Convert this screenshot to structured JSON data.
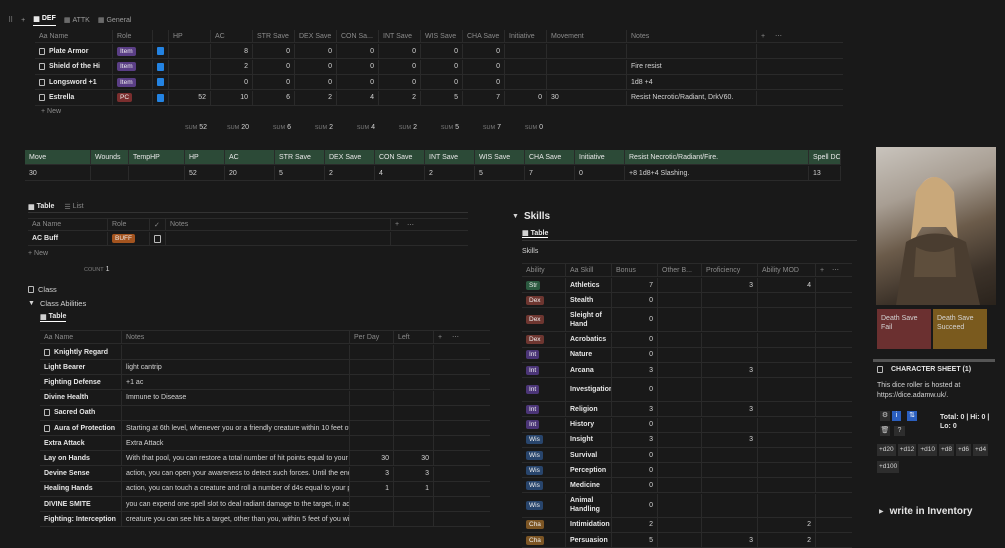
{
  "topbar": {
    "tabs": [
      "DEF",
      "ATTK",
      "General"
    ]
  },
  "stats_db": {
    "headers": [
      "Aa Name",
      "Role",
      "",
      "HP",
      "AC",
      "STR Save",
      "DEX Save",
      "CON Sa...",
      "INT Save",
      "WIS Save",
      "CHA Save",
      "Initiative",
      "Movement",
      "Notes"
    ],
    "rows": [
      {
        "name": "Plate Armor",
        "role": "Item",
        "hp": "",
        "ac": "8",
        "str": "0",
        "dex": "0",
        "con": "0",
        "int": "0",
        "wis": "0",
        "cha": "0",
        "init": "",
        "move": "",
        "notes": ""
      },
      {
        "name": "Shield of the Hi",
        "role": "Item",
        "hp": "",
        "ac": "2",
        "str": "0",
        "dex": "0",
        "con": "0",
        "int": "0",
        "wis": "0",
        "cha": "0",
        "init": "",
        "move": "",
        "notes": "Fire resist"
      },
      {
        "name": "Longsword +1",
        "role": "Item",
        "hp": "",
        "ac": "0",
        "str": "0",
        "dex": "0",
        "con": "0",
        "int": "0",
        "wis": "0",
        "cha": "0",
        "init": "",
        "move": "",
        "notes": "1d8 +4"
      },
      {
        "name": "Estrella",
        "role": "PC",
        "hp": "52",
        "ac": "10",
        "str": "6",
        "dex": "2",
        "con": "4",
        "int": "2",
        "wis": "5",
        "cha": "7",
        "init": "0",
        "move": "30",
        "notes": "Resist Necrotic/Radiant, DrkV60."
      }
    ],
    "new_label": "New",
    "sum_label": "SUM",
    "sums": [
      "52",
      "20",
      "6",
      "2",
      "4",
      "2",
      "5",
      "7",
      "0"
    ]
  },
  "summary": {
    "headers": [
      "Move",
      "Wounds",
      "TempHP",
      "HP",
      "AC",
      "STR Save",
      "DEX Save",
      "CON Save",
      "INT Save",
      "WIS Save",
      "CHA Save",
      "Initiative",
      "Resist Necrotic/Radiant/Fire.",
      "Spell DC"
    ],
    "values": [
      "30",
      "",
      "",
      "52",
      "20",
      "5",
      "2",
      "4",
      "2",
      "5",
      "7",
      "0",
      "+8 1d8+4 Slashing.",
      "13"
    ]
  },
  "buff_db": {
    "tabs": [
      "Table",
      "List"
    ],
    "headers": [
      "Aa Name",
      "Role",
      "",
      "Notes"
    ],
    "row": {
      "name": "AC Buff",
      "role": "BUFF"
    },
    "new_label": "New",
    "count_label": "COUNT",
    "count": "1"
  },
  "class_section": {
    "page": "Class",
    "toggle": "Class Abilities",
    "tab": "Table"
  },
  "abilities": {
    "headers": [
      "Aa Name",
      "Notes",
      "Per Day",
      "Left"
    ],
    "rows": [
      {
        "name": "Knightly Regard",
        "notes": "",
        "per": "",
        "left": ""
      },
      {
        "name": "Light Bearer",
        "notes": "light cantrip",
        "per": "",
        "left": ""
      },
      {
        "name": "Fighting Defense",
        "notes": "+1 ac",
        "per": "",
        "left": ""
      },
      {
        "name": "Divine Health",
        "notes": "Immune to Disease",
        "per": "",
        "left": ""
      },
      {
        "name": "Sacred Oath",
        "notes": "",
        "per": "",
        "left": ""
      },
      {
        "name": "Aura of Protection",
        "notes": "Starting at 6th level, whenever you or a friendly creature within 10 feet of you m",
        "per": "",
        "left": ""
      },
      {
        "name": "Extra Attack",
        "notes": "Extra Attack",
        "per": "",
        "left": ""
      },
      {
        "name": "Lay on Hands",
        "notes": "With that pool, you can restore a total number of hit points equal to your palad",
        "per": "30",
        "left": "30"
      },
      {
        "name": "Devine Sense",
        "notes": "action, you can open your awareness to detect such forces. Until the end of you",
        "per": "3",
        "left": "3"
      },
      {
        "name": "Healing Hands",
        "notes": "action, you can touch a creature and roll a number of d4s equal to your proficie",
        "per": "1",
        "left": "1"
      },
      {
        "name": "DIVINE SMITE",
        "notes": "you can expend one spell slot to deal radiant damage to the target, in addition",
        "per": "",
        "left": ""
      },
      {
        "name": "Fighting: Interception",
        "notes": "creature you can see hits a target, other than you, within 5 feet of you with an a",
        "per": "",
        "left": ""
      }
    ]
  },
  "skills_section": {
    "toggle": "Skills",
    "tab": "Table",
    "title": "Skills",
    "headers": [
      "Ability",
      "Aa Skill",
      "Bonus",
      "Other B...",
      "Proficiency",
      "Ability MOD"
    ],
    "rows": [
      {
        "ab": "Str",
        "skill": "Athletics",
        "bonus": "7",
        "other": "",
        "prof": "3",
        "mod": "4"
      },
      {
        "ab": "Dex",
        "skill": "Stealth",
        "bonus": "0",
        "other": "",
        "prof": "",
        "mod": ""
      },
      {
        "ab": "Dex",
        "skill": "Sleight of Hand",
        "bonus": "0",
        "other": "",
        "prof": "",
        "mod": ""
      },
      {
        "ab": "Dex",
        "skill": "Acrobatics",
        "bonus": "0",
        "other": "",
        "prof": "",
        "mod": ""
      },
      {
        "ab": "Int",
        "skill": "Nature",
        "bonus": "0",
        "other": "",
        "prof": "",
        "mod": ""
      },
      {
        "ab": "Int",
        "skill": "Arcana",
        "bonus": "3",
        "other": "",
        "prof": "3",
        "mod": ""
      },
      {
        "ab": "Int",
        "skill": "Investigation",
        "bonus": "0",
        "other": "",
        "prof": "",
        "mod": ""
      },
      {
        "ab": "Int",
        "skill": "Religion",
        "bonus": "3",
        "other": "",
        "prof": "3",
        "mod": ""
      },
      {
        "ab": "Int",
        "skill": "History",
        "bonus": "0",
        "other": "",
        "prof": "",
        "mod": ""
      },
      {
        "ab": "Wis",
        "skill": "Insight",
        "bonus": "3",
        "other": "",
        "prof": "3",
        "mod": ""
      },
      {
        "ab": "Wis",
        "skill": "Survival",
        "bonus": "0",
        "other": "",
        "prof": "",
        "mod": ""
      },
      {
        "ab": "Wis",
        "skill": "Perception",
        "bonus": "0",
        "other": "",
        "prof": "",
        "mod": ""
      },
      {
        "ab": "Wis",
        "skill": "Medicine",
        "bonus": "0",
        "other": "",
        "prof": "",
        "mod": ""
      },
      {
        "ab": "Wis",
        "skill": "Animal Handling",
        "bonus": "0",
        "other": "",
        "prof": "",
        "mod": ""
      },
      {
        "ab": "Cha",
        "skill": "Intimidation",
        "bonus": "2",
        "other": "",
        "prof": "",
        "mod": "2"
      },
      {
        "ab": "Cha",
        "skill": "Persuasion",
        "bonus": "5",
        "other": "",
        "prof": "3",
        "mod": "2"
      }
    ]
  },
  "right": {
    "death_fail": "Death Save Fail",
    "death_succeed": "Death Save Succeed",
    "sheet_title": "CHARACTER SHEET (1)",
    "dice_text": "This dice roller is hosted at https://dice.adamw.uk/.",
    "total_text": "Total: 0 | Hi: 0 | Lo: 0",
    "dice": [
      "+d20",
      "+d12",
      "+d10",
      "+d8",
      "+d6",
      "+d4",
      "+d100"
    ],
    "inventory": "write in Inventory"
  },
  "colors": {
    "bg": "#191919",
    "item": "#5a3e85",
    "pc": "#7a2e2e",
    "buff": "#a4541f",
    "str": "#2b593f",
    "dex": "#6e3630",
    "int": "#4b3577",
    "wis": "#28456c",
    "cha": "#7c5524",
    "header_green": "#2c4a37",
    "fail": "#6b3030",
    "succeed": "#7a5a1e"
  }
}
